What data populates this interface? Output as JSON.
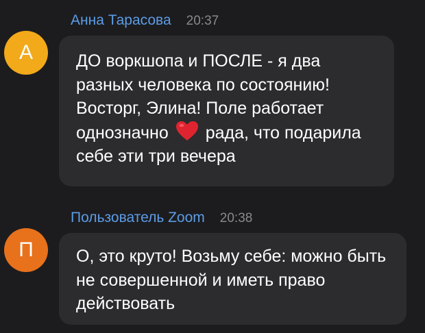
{
  "messages": [
    {
      "author": "Анна Тарасова",
      "time": "20:37",
      "avatar_letter": "А",
      "avatar_color": "#f2a91a",
      "text_before_emoji": "ДО воркшопа и ПОСЛЕ - я два разных человека по состоянию! Восторг, Элина! Поле работает однозначно",
      "emoji": "heart-icon",
      "text_after_emoji": "рада, что подарила себе эти три вечера"
    },
    {
      "author": "Пользователь Zoom",
      "time": "20:38",
      "avatar_letter": "П",
      "avatar_color": "#e8711c",
      "text": "О, это круто! Возьму себе: можно быть не совершенной и иметь право действовать"
    }
  ],
  "colors": {
    "background": "#1c1c1e",
    "bubble": "#2c2c2e",
    "author_name": "#5c9ce6",
    "timestamp": "#8a8a8e",
    "heart": "#e0242f"
  }
}
